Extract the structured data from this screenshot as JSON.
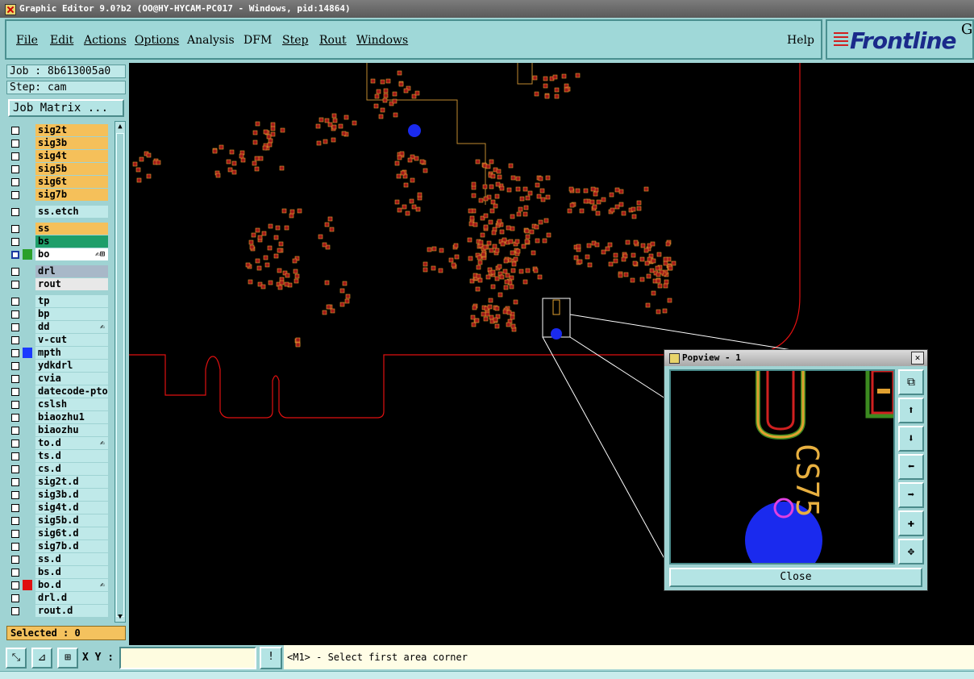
{
  "window": {
    "title": "Graphic Editor 9.0?b2 (OO@HY-HYCAM-PC017 - Windows, pid:14864)"
  },
  "menu": {
    "items": [
      {
        "label": "File"
      },
      {
        "label": "Edit"
      },
      {
        "label": "Actions"
      },
      {
        "label": "Options"
      },
      {
        "label": "Analysis"
      },
      {
        "label": "DFM"
      },
      {
        "label": "Step"
      },
      {
        "label": "Rout"
      },
      {
        "label": "Windows"
      }
    ],
    "help": "Help"
  },
  "logo": {
    "name": "Frontline",
    "suffix": "G"
  },
  "panel": {
    "job": "Job : 8b613005a0",
    "step": "Step: cam",
    "job_matrix": "Job Matrix ...",
    "selected": "Selected : 0"
  },
  "layers": [
    {
      "name": "sig2t",
      "color": "#f5c05a",
      "indicator": ""
    },
    {
      "name": "sig3b",
      "color": "#f5c05a",
      "indicator": ""
    },
    {
      "name": "sig4t",
      "color": "#f5c05a",
      "indicator": ""
    },
    {
      "name": "sig5b",
      "color": "#f5c05a",
      "indicator": ""
    },
    {
      "name": "sig6t",
      "color": "#f5c05a",
      "indicator": ""
    },
    {
      "name": "sig7b",
      "color": "#f5c05a",
      "indicator": ""
    },
    {
      "name": "ss.etch",
      "color": "#bfe9e9",
      "indicator": ""
    },
    {
      "name": "ss",
      "color": "#f5c05a",
      "indicator": ""
    },
    {
      "name": "bs",
      "color": "#1e9e6a",
      "indicator": ""
    },
    {
      "name": "bo",
      "color": "#ffffff",
      "indicator": "#2aa02a",
      "active": true,
      "mark": "✍⊞"
    },
    {
      "name": "drl",
      "color": "#a8b8c8",
      "indicator": ""
    },
    {
      "name": "rout",
      "color": "#e8e8e8",
      "indicator": ""
    },
    {
      "name": "tp",
      "color": "#bfe9e9",
      "indicator": ""
    },
    {
      "name": "bp",
      "color": "#bfe9e9",
      "indicator": ""
    },
    {
      "name": "dd",
      "color": "#bfe9e9",
      "indicator": "",
      "mark": "✍"
    },
    {
      "name": "v-cut",
      "color": "#bfe9e9",
      "indicator": ""
    },
    {
      "name": "mpth",
      "color": "#bfe9e9",
      "indicator": "#1a3aff"
    },
    {
      "name": "ydkdrl",
      "color": "#bfe9e9",
      "indicator": ""
    },
    {
      "name": "cvia",
      "color": "#bfe9e9",
      "indicator": ""
    },
    {
      "name": "datecode-pto",
      "color": "#bfe9e9",
      "indicator": ""
    },
    {
      "name": "cslsh",
      "color": "#bfe9e9",
      "indicator": ""
    },
    {
      "name": "biaozhu1",
      "color": "#bfe9e9",
      "indicator": ""
    },
    {
      "name": "biaozhu",
      "color": "#bfe9e9",
      "indicator": ""
    },
    {
      "name": "to.d",
      "color": "#bfe9e9",
      "indicator": "",
      "mark": "✍"
    },
    {
      "name": "ts.d",
      "color": "#bfe9e9",
      "indicator": ""
    },
    {
      "name": "cs.d",
      "color": "#bfe9e9",
      "indicator": ""
    },
    {
      "name": "sig2t.d",
      "color": "#bfe9e9",
      "indicator": ""
    },
    {
      "name": "sig3b.d",
      "color": "#bfe9e9",
      "indicator": ""
    },
    {
      "name": "sig4t.d",
      "color": "#bfe9e9",
      "indicator": ""
    },
    {
      "name": "sig5b.d",
      "color": "#bfe9e9",
      "indicator": ""
    },
    {
      "name": "sig6t.d",
      "color": "#bfe9e9",
      "indicator": ""
    },
    {
      "name": "sig7b.d",
      "color": "#bfe9e9",
      "indicator": ""
    },
    {
      "name": "ss.d",
      "color": "#bfe9e9",
      "indicator": ""
    },
    {
      "name": "bs.d",
      "color": "#bfe9e9",
      "indicator": ""
    },
    {
      "name": "bo.d",
      "color": "#bfe9e9",
      "indicator": "#e01010",
      "mark": "✍"
    },
    {
      "name": "drl.d",
      "color": "#bfe9e9",
      "indicator": ""
    },
    {
      "name": "rout.d",
      "color": "#bfe9e9",
      "indicator": ""
    }
  ],
  "statusbar": {
    "xy_label": "X Y :",
    "xy_value": "",
    "message": "<M1> - Select first area corner"
  },
  "popview": {
    "title": "Popview - 1",
    "close": "Close",
    "silk_text": "CS75"
  },
  "colors": {
    "board_outline": "#e01010",
    "pad": "#c02020",
    "pad_ring": "#e0a030",
    "silk": "#e8b040",
    "via": "#1a2aee"
  }
}
